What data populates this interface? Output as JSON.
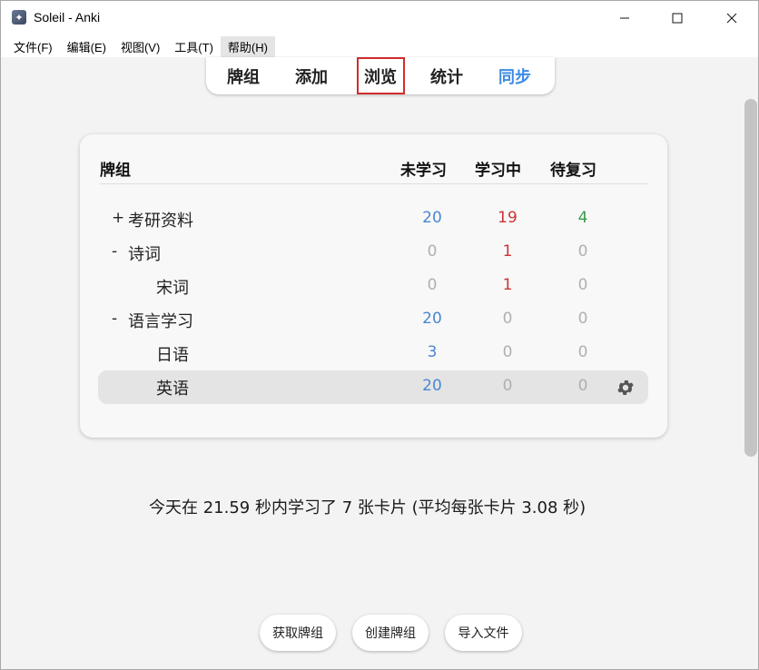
{
  "window": {
    "title": "Soleil - Anki",
    "app_icon": "anki-star-icon"
  },
  "menubar": {
    "items": [
      "文件(F)",
      "编辑(E)",
      "视图(V)",
      "工具(T)",
      "帮助(H)"
    ]
  },
  "toolbar": {
    "decks_label": "牌组",
    "add_label": "添加",
    "browse_label": "浏览",
    "stats_label": "统计",
    "sync_label": "同步",
    "sync_color": "#3d8be6",
    "highlight_color": "#d22c2c"
  },
  "deck_table": {
    "headers": {
      "deck": "牌组",
      "new": "未学习",
      "learn": "学习中",
      "due": "待复习"
    },
    "rows": [
      {
        "toggle": "+",
        "name": "考研资料",
        "new": "20",
        "learn": "19",
        "due": "4",
        "selected": false,
        "indent": 0
      },
      {
        "toggle": "-",
        "name": "诗词",
        "new": "0",
        "learn": "1",
        "due": "0",
        "selected": false,
        "indent": 0
      },
      {
        "toggle": "",
        "name": "宋词",
        "new": "0",
        "learn": "1",
        "due": "0",
        "selected": false,
        "indent": 1
      },
      {
        "toggle": "-",
        "name": "语言学习",
        "new": "20",
        "learn": "0",
        "due": "0",
        "selected": false,
        "indent": 0
      },
      {
        "toggle": "",
        "name": "日语",
        "new": "3",
        "learn": "0",
        "due": "0",
        "selected": false,
        "indent": 1
      },
      {
        "toggle": "",
        "name": "英语",
        "new": "20",
        "learn": "0",
        "due": "0",
        "selected": true,
        "indent": 1
      }
    ],
    "colors": {
      "new": "#4a86d4",
      "learn": "#cc3333",
      "due": "#3a9a4a",
      "zero": "#b0b0b0"
    },
    "gear_icon": "gear-icon"
  },
  "stats": {
    "summary": "今天在 21.59 秒内学习了 7 张卡片 (平均每张卡片 3.08 秒)"
  },
  "bottom_buttons": {
    "get_shared": "获取牌组",
    "create_deck": "创建牌组",
    "import_file": "导入文件"
  }
}
